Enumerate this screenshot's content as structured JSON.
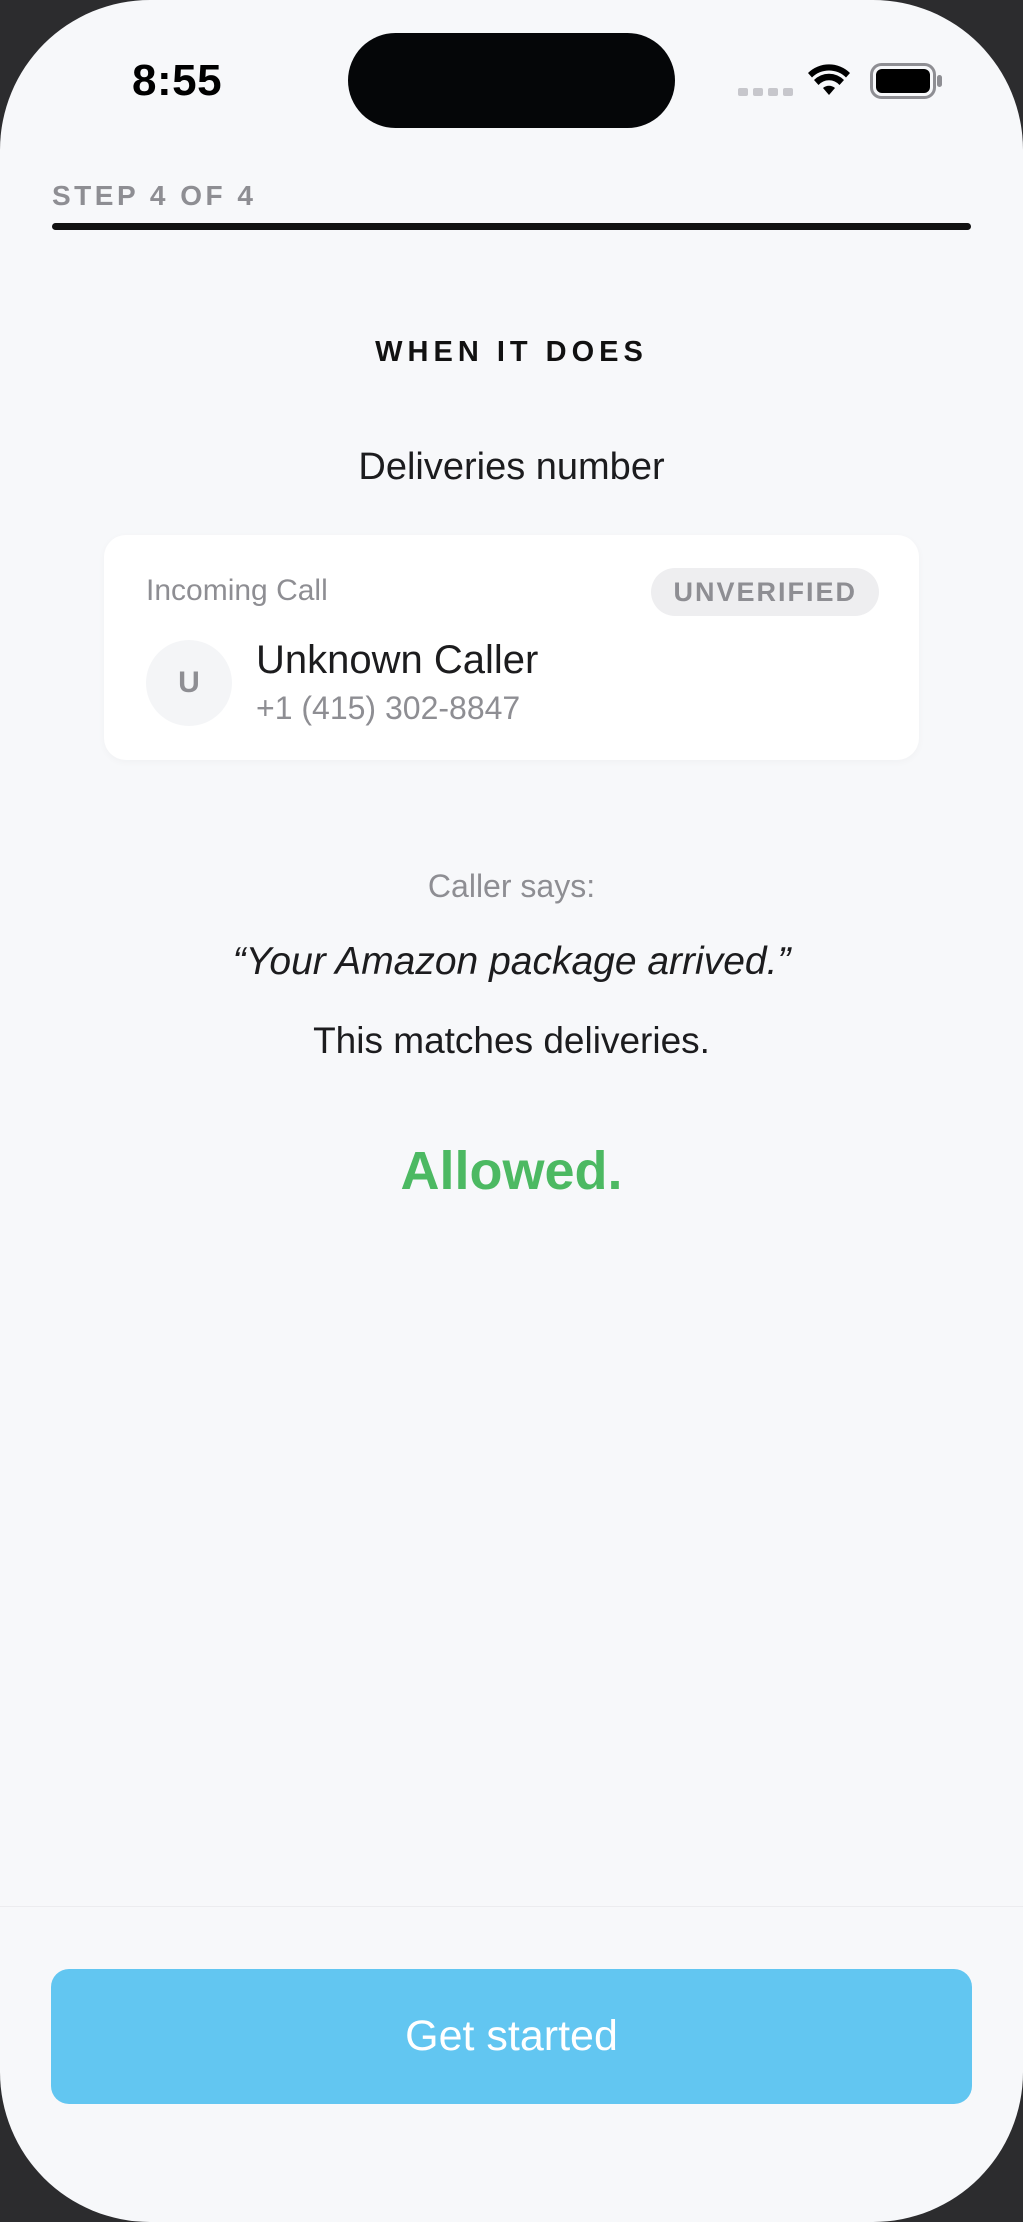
{
  "status_bar": {
    "time": "8:55",
    "icons": [
      "cellular-signal-icon",
      "wifi-icon",
      "battery-icon"
    ]
  },
  "progress": {
    "label": "STEP 4 OF 4",
    "fraction": 1.0
  },
  "section": {
    "heading": "WHEN IT DOES",
    "title": "Deliveries number"
  },
  "call_card": {
    "label": "Incoming Call",
    "badge": "UNVERIFIED",
    "avatar_initial": "U",
    "caller_name": "Unknown Caller",
    "caller_number": "+1 (415) 302-8847"
  },
  "screening": {
    "caller_says_label": "Caller says:",
    "quote": "“Your Amazon package arrived.”",
    "match_text": "This matches deliveries.",
    "verdict": "Allowed."
  },
  "cta": {
    "label": "Get started"
  },
  "colors": {
    "accent": "#62c6f1",
    "allowed": "#4cb962",
    "background": "#f7f8fa"
  }
}
